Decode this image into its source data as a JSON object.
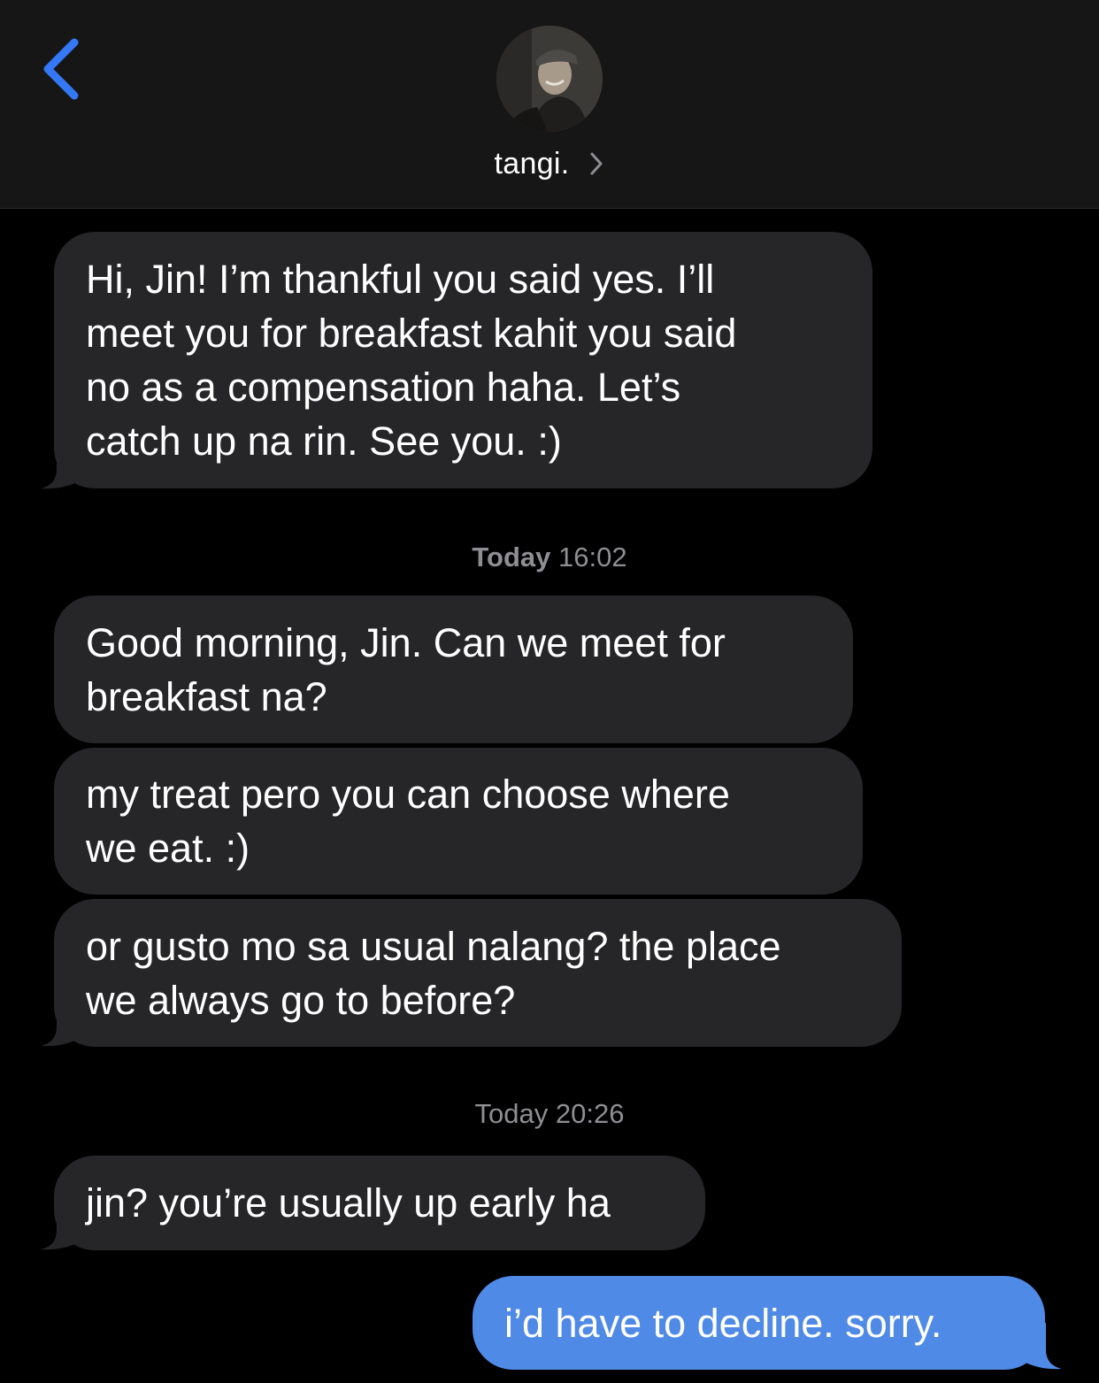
{
  "header": {
    "back_icon": "chevron-left-icon",
    "contact_name": "tangi.",
    "contact_chevron_icon": "chevron-right-icon",
    "accent_color": "#3478f6"
  },
  "messages": [
    {
      "direction": "incoming",
      "text": "Hi, Jin! I’m thankful you said yes. I’ll\nmeet you for breakfast kahit you said\nno as a compensation haha. Let’s\ncatch up na rin. See you. :)"
    },
    {
      "direction": "incoming",
      "text": "Good morning, Jin. Can we meet for\nbreakfast na?"
    },
    {
      "direction": "incoming",
      "text": "my treat pero you can choose where\nwe eat. :)"
    },
    {
      "direction": "incoming",
      "text": "or gusto mo sa usual nalang? the place\nwe always go to before?"
    },
    {
      "direction": "incoming",
      "text": "jin? you’re usually up early ha"
    },
    {
      "direction": "outgoing",
      "text": "i’d have to decline. sorry."
    }
  ],
  "timestamps": [
    {
      "day": "Today",
      "time": "16:02"
    },
    {
      "day": "Today",
      "time": "20:26"
    }
  ],
  "colors": {
    "background": "#000000",
    "header_background": "#161616",
    "incoming_bubble": "#262629",
    "outgoing_bubble": "#4f8ae6",
    "timestamp_text": "#8e8e93"
  }
}
